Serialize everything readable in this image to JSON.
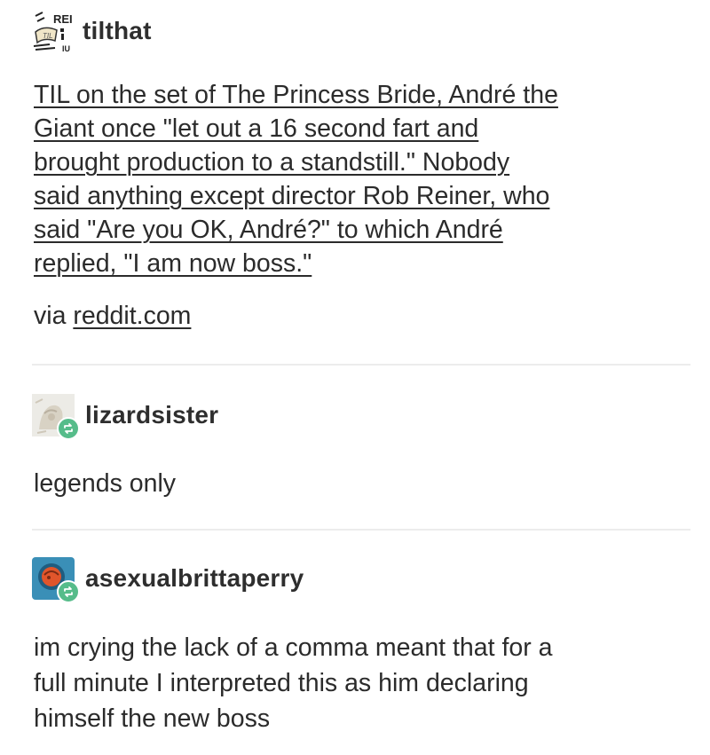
{
  "posts": [
    {
      "username": "tilthat",
      "avatar_icon": "tilthat-avatar-icon",
      "avatar_text": "REI",
      "lines": [
        "TIL on the set of The Princess Bride, André the",
        "Giant once \"let out a 16 second fart and",
        "brought production to a standstill.\" Nobody",
        "said anything except director Rob Reiner, who",
        "said \"Are you OK, André?\" to which André",
        "replied, \"I am now boss.\""
      ],
      "via_prefix": "via",
      "via_source": "reddit.com"
    },
    {
      "username": "lizardsister",
      "avatar_icon": "lizardsister-avatar-icon",
      "text": "legends only"
    },
    {
      "username": "asexualbrittaperry",
      "avatar_icon": "asexualbrittaperry-avatar-icon",
      "lines": [
        "im crying the lack of a comma meant that for a",
        "full minute I interpreted this as him declaring",
        "himself the new boss"
      ]
    }
  ],
  "colors": {
    "text": "#2b2b2b",
    "divider": "#ececec",
    "reblog_badge": "#56bc8a",
    "avatar3_bg": "#3a8fb7",
    "avatar3_accent": "#e0552b"
  },
  "badge_icon": "reblog-icon"
}
